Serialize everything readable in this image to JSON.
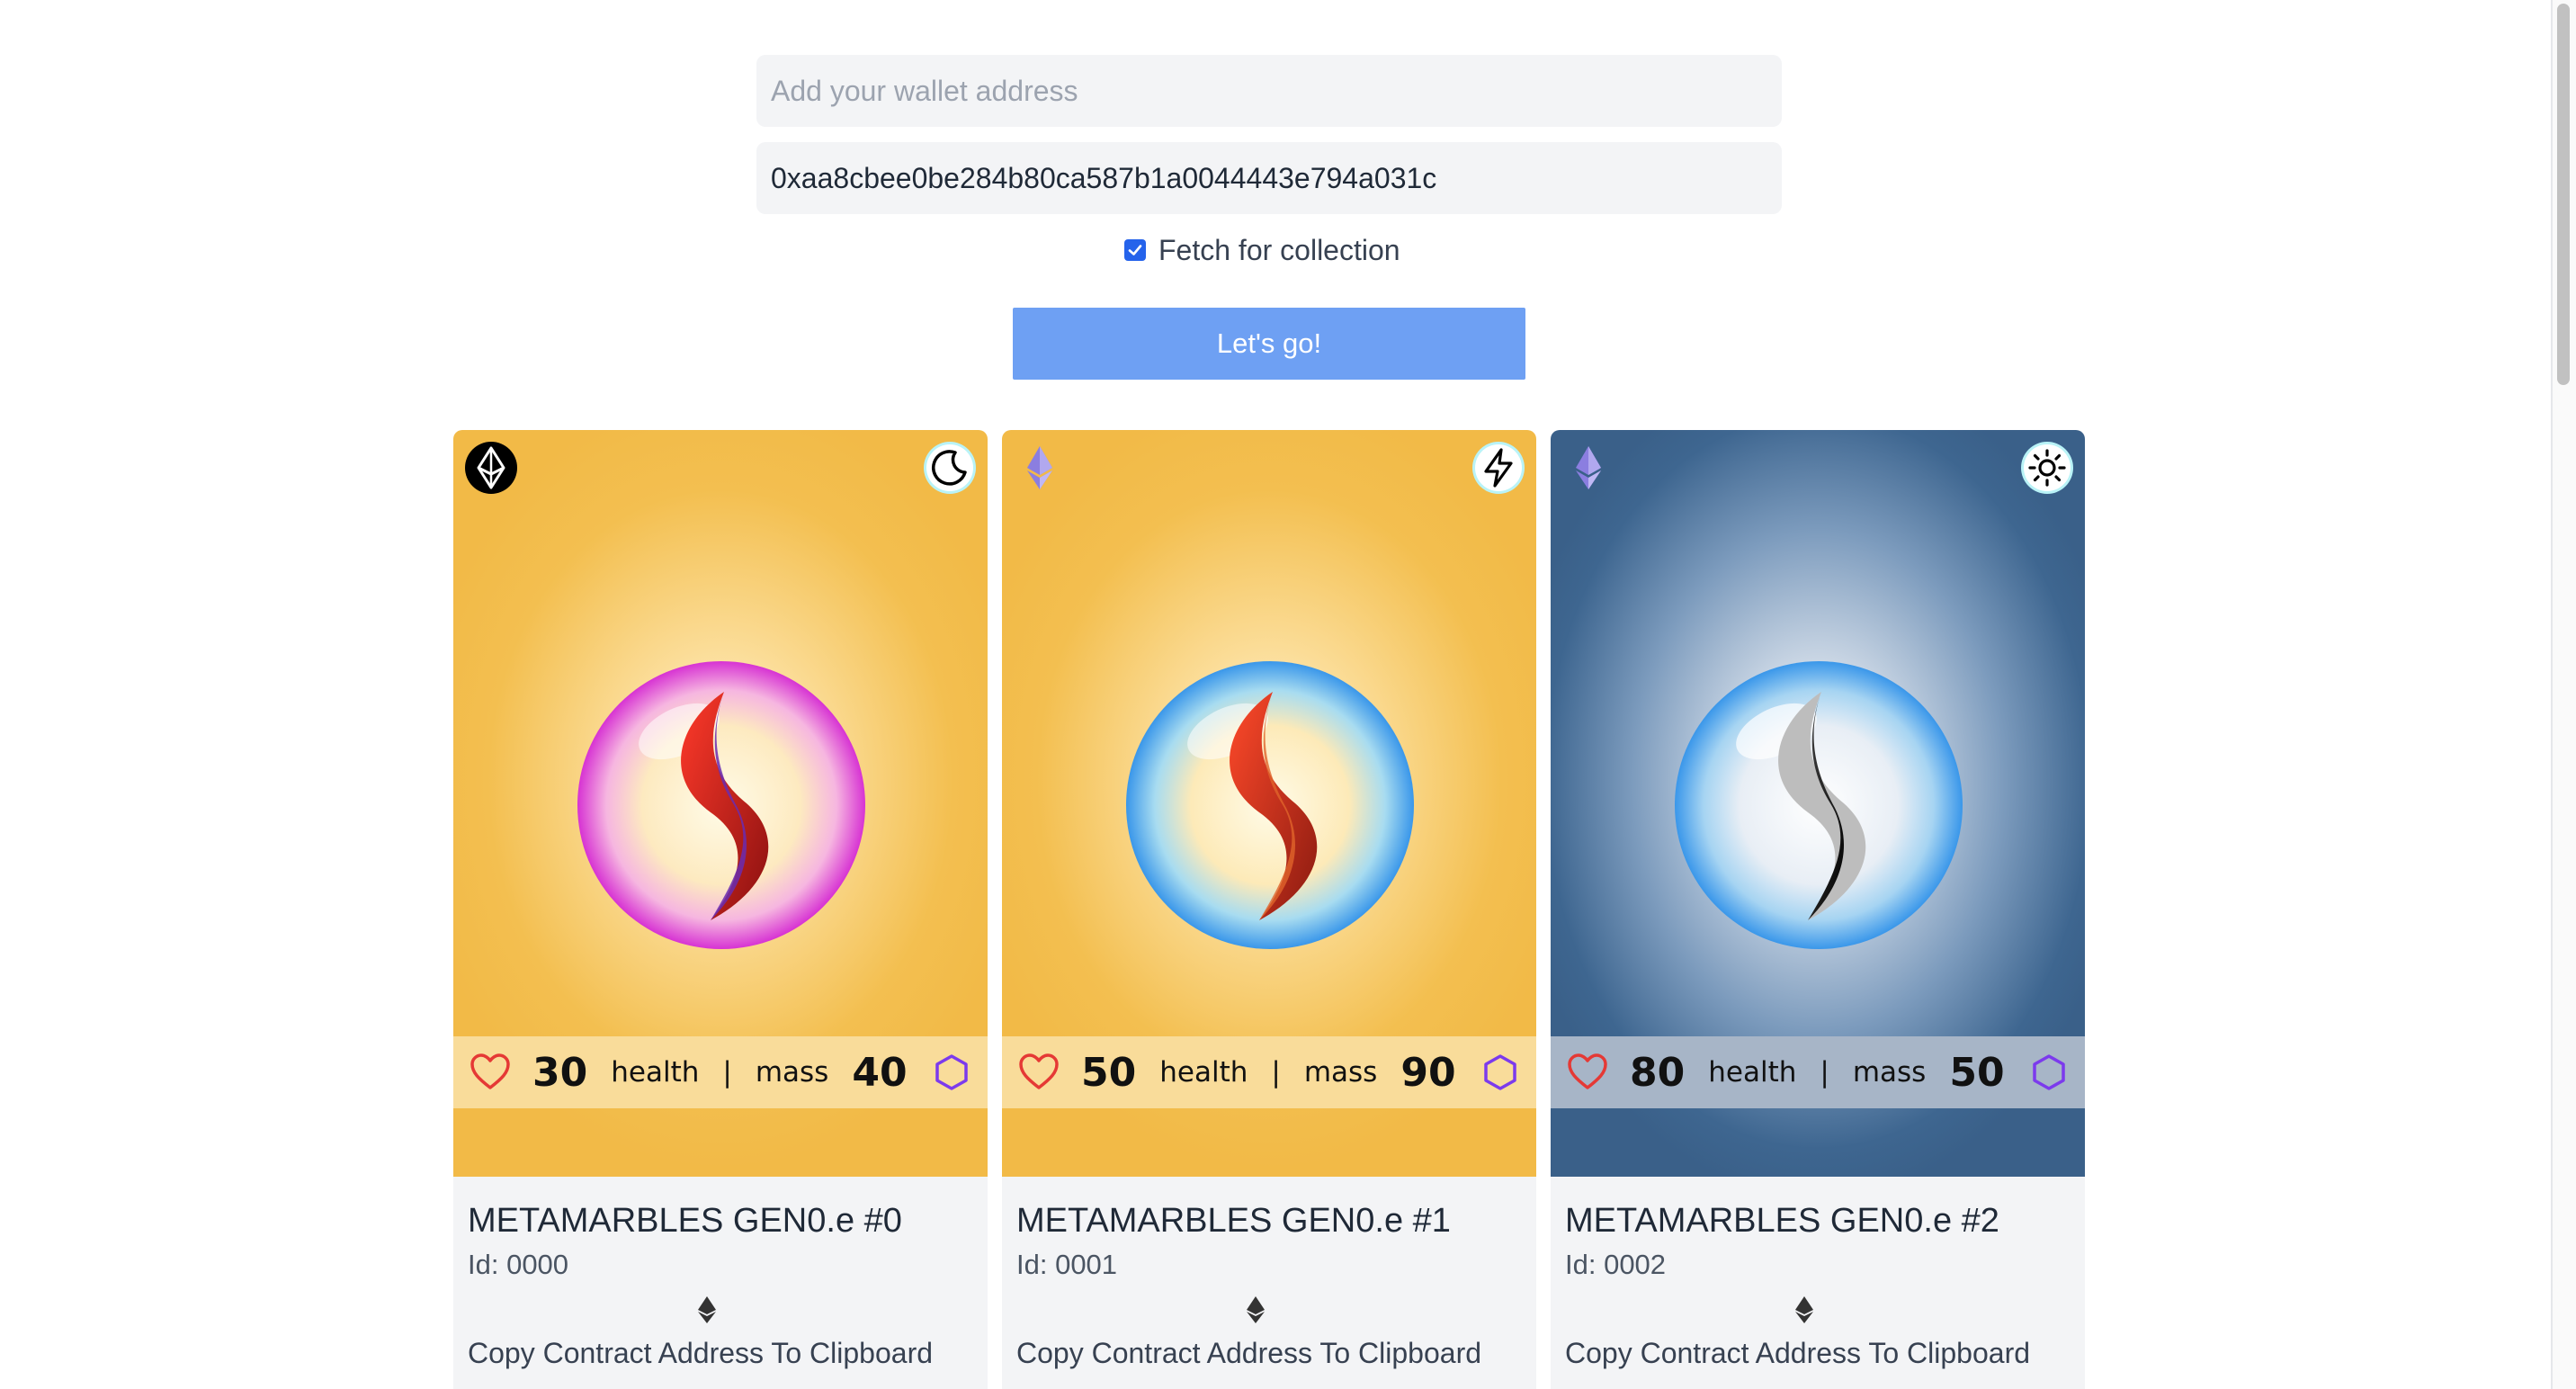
{
  "form": {
    "wallet_placeholder": "Add your wallet address",
    "wallet_value": "",
    "contract_value": "0xaa8cbee0be284b80ca587b1a0044443e794a031c",
    "fetch_label": "Fetch for collection",
    "fetch_checked": true,
    "submit_label": "Let's go!"
  },
  "labels": {
    "health": "health",
    "separator": "|",
    "mass": "mass"
  },
  "cards": [
    {
      "name": "METAMARBLES GEN0.e #0",
      "id": "Id: 0000",
      "health": "30",
      "mass": "40",
      "type_icon": "moon-icon",
      "eth_icon": "ethereum-badge-dark-icon",
      "background": "gold",
      "marble_rim": "#e040e0",
      "copy_label": "Copy Contract Address To Clipboard"
    },
    {
      "name": "METAMARBLES GEN0.e #1",
      "id": "Id: 0001",
      "health": "50",
      "mass": "90",
      "type_icon": "lightning-icon",
      "eth_icon": "ethereum-purple-icon",
      "background": "gold",
      "marble_rim": "#3b9cf0",
      "copy_label": "Copy Contract Address To Clipboard"
    },
    {
      "name": "METAMARBLES GEN0.e #2",
      "id": "Id: 0002",
      "health": "80",
      "mass": "50",
      "type_icon": "sun-icon",
      "eth_icon": "ethereum-purple-icon",
      "background": "blue",
      "marble_rim": "#3b9cf0",
      "copy_label": "Copy Contract Address To Clipboard"
    }
  ],
  "colors": {
    "button": "#6ea0f3",
    "card_gold": "#f2ba47",
    "card_blue": "#3e6690",
    "heart": "#e53935",
    "hexagon": "#7c3aed"
  }
}
